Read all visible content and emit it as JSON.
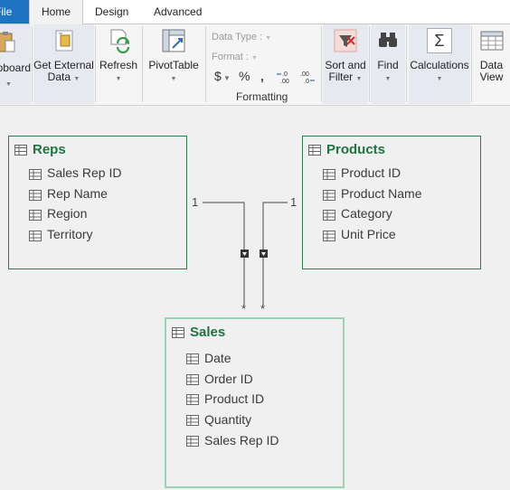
{
  "tabs": {
    "file": "File",
    "home": "Home",
    "design": "Design",
    "advanced": "Advanced"
  },
  "ribbon": {
    "clipboard": "Clipboard",
    "get_external_data": [
      "Get External",
      "Data"
    ],
    "refresh": "Refresh",
    "pivottable": "PivotTable",
    "formatting": {
      "data_type_label": "Data Type :",
      "format_label": "Format :",
      "currency_symbol": "$",
      "percent_symbol": "%",
      "comma_symbol": "‚",
      "inc_decimal": "←.0\n.00",
      "dec_decimal": ".00\n→.0",
      "group_title": "Formatting"
    },
    "sort_and_filter": [
      "Sort and",
      "Filter"
    ],
    "find": "Find",
    "calculations": "Calculations",
    "calc_symbol": "Σ",
    "data_view": [
      "Data",
      "View"
    ]
  },
  "diagram": {
    "reps": {
      "title": "Reps",
      "fields": [
        "Sales Rep ID",
        "Rep Name",
        "Region",
        "Territory"
      ]
    },
    "products": {
      "title": "Products",
      "fields": [
        "Product ID",
        "Product Name",
        "Category",
        "Unit Price"
      ]
    },
    "sales": {
      "title": "Sales",
      "fields": [
        "Date",
        "Order ID",
        "Product ID",
        "Quantity",
        "Sales Rep ID"
      ]
    },
    "relationships": {
      "reps_end": "1",
      "products_end": "1",
      "sales_end_a": "*",
      "sales_end_b": "*"
    }
  },
  "colors": {
    "accent_blue": "#1e73c4",
    "table_title_green": "#1f7340",
    "table_border": "#2f7a4b",
    "selected_border": "#9ad4b4"
  }
}
